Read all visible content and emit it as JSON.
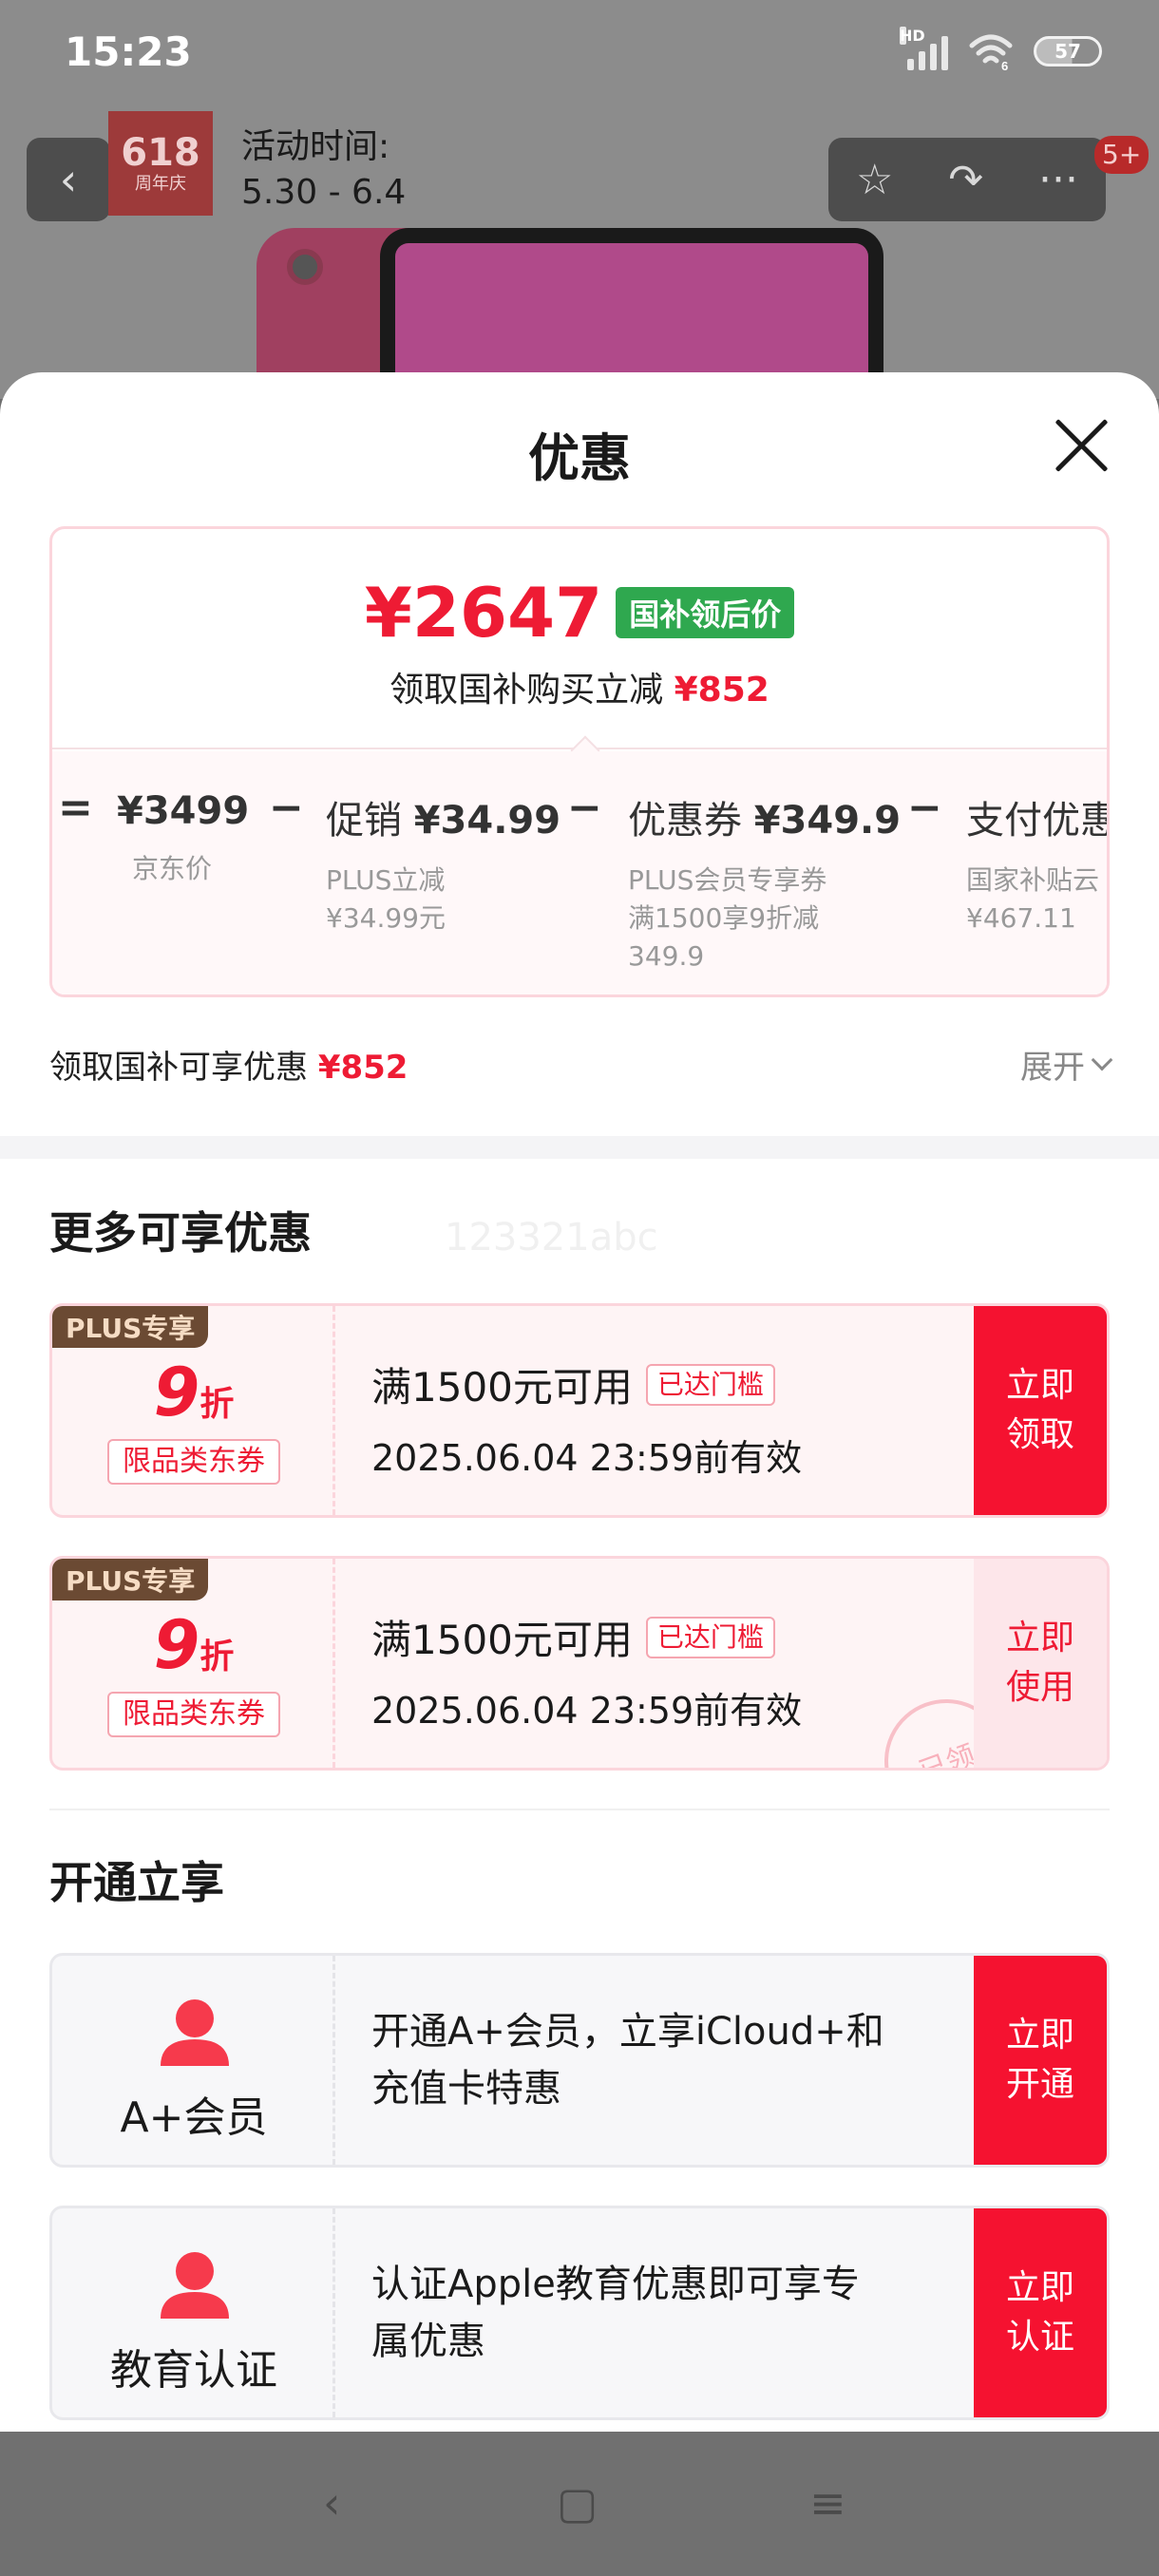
{
  "status_bar": {
    "time": "15:23",
    "network_label": "HD",
    "wifi_label": "6",
    "battery": "57"
  },
  "background_page": {
    "logo_main": "618",
    "logo_sub": "周年庆",
    "activity_label": "活动时间:",
    "activity_dates": "5.30 - 6.4",
    "back_icon": "‹",
    "star_icon": "☆",
    "share_icon": "↷",
    "more_icon": "···",
    "badge": "5+"
  },
  "sheet": {
    "title": "优惠"
  },
  "price_card": {
    "price": "¥2647",
    "price_tag": "国补领后价",
    "subsidy_text": "领取国补购买立减",
    "subsidy_amount": "¥852",
    "breakdown": [
      {
        "op": "=",
        "label": "",
        "value": "¥3499",
        "desc": [
          "京东价"
        ]
      },
      {
        "op": "−",
        "label": "促销",
        "value": "¥34.99",
        "desc": [
          "PLUS立减",
          "¥34.99元"
        ]
      },
      {
        "op": "−",
        "label": "优惠券",
        "value": "¥349.9",
        "desc": [
          "PLUS会员专享券",
          "满1500享9折减",
          "349.9"
        ]
      },
      {
        "op": "−",
        "label": "支付优惠",
        "value": "",
        "desc": [
          "国家补贴云",
          "¥467.11"
        ]
      }
    ]
  },
  "expand_row": {
    "text": "领取国补可享优惠",
    "amount": "¥852",
    "expand_label": "展开"
  },
  "more_offers": {
    "title": "更多可享优惠",
    "watermark": "123321abc",
    "coupons": [
      {
        "tag": "PLUS专享",
        "discount": "9",
        "discount_unit": "折",
        "type": "限品类东券",
        "condition": "满1500元可用",
        "met_tag": "已达门槛",
        "expiry": "2025.06.04 23:59前有效",
        "action_line1": "立即",
        "action_line2": "领取",
        "stamp": ""
      },
      {
        "tag": "PLUS专享",
        "discount": "9",
        "discount_unit": "折",
        "type": "限品类东券",
        "condition": "满1500元可用",
        "met_tag": "已达门槛",
        "expiry": "2025.06.04 23:59前有效",
        "action_line1": "立即",
        "action_line2": "使用",
        "stamp": "已领"
      }
    ]
  },
  "activate": {
    "title": "开通立享",
    "items": [
      {
        "name": "A+会员",
        "desc_line1": "开通A+会员，立享iCloud+和",
        "desc_line2": "充值卡特惠",
        "action_line1": "立即",
        "action_line2": "开通"
      },
      {
        "name": "教育认证",
        "desc_line1": "认证Apple教育优惠即可享专",
        "desc_line2": "属优惠",
        "action_line1": "立即",
        "action_line2": "认证"
      }
    ]
  },
  "nav_bar": {
    "back": "‹",
    "home": "▢",
    "menu": "≡"
  },
  "colors": {
    "accent_red": "#ee1b34",
    "action_red": "#f51230",
    "tag_green": "#2fa84f",
    "plus_brown": "#6b4a33"
  }
}
